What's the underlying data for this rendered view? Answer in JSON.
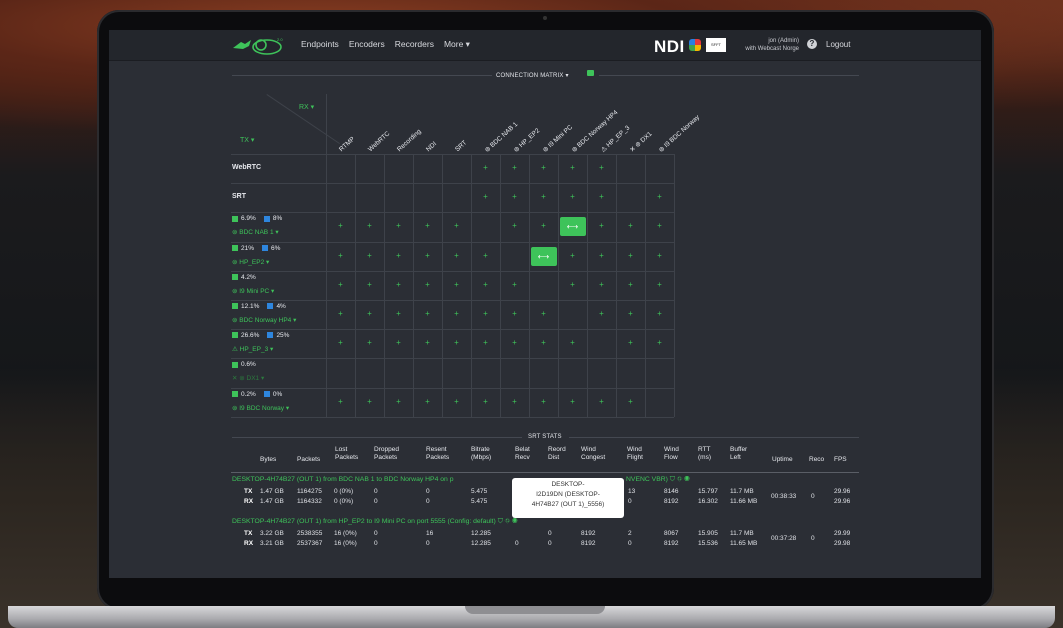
{
  "nav": {
    "items": [
      "Endpoints",
      "Encoders",
      "Recorders",
      "More ▾"
    ]
  },
  "brand": {
    "ndi": "NDI",
    "box": "SFFT",
    "user_line1": "jon (Admin)",
    "user_line2": "with Webcast Norge",
    "logout": "Logout",
    "accent": "#3ec35a"
  },
  "matrix": {
    "title": "CONNECTION MATRIX ▾",
    "rx_label": "RX ▾",
    "tx_label": "TX ▾",
    "columns": [
      "RTMP",
      "WebRTC",
      "Recording",
      "NDI",
      "SRT",
      "⊚ BDC NAB 1",
      "⊚ HP_EP2",
      "⊚ I9 Mini PC",
      "⊚ BDC Norway HP4",
      "⚠ HP_EP_3",
      "✕ ⊚ DX1",
      "⊚ I9 BDC Norway"
    ],
    "rows": [
      {
        "label": "WebRTC",
        "type": "head",
        "plus": [
          5,
          6,
          7,
          8,
          9
        ]
      },
      {
        "label": "SRT",
        "type": "head",
        "plus": [
          5,
          6,
          7,
          8,
          9,
          11
        ]
      },
      {
        "name": "⊚ BDC NAB 1 ▾",
        "g": "6.9%",
        "b": "8%",
        "plus": [
          0,
          1,
          2,
          3,
          4,
          6,
          7,
          9,
          10,
          11
        ],
        "active": 8
      },
      {
        "name": "⊚ HP_EP2 ▾",
        "g": "21%",
        "b": "6%",
        "plus": [
          0,
          1,
          2,
          3,
          4,
          5,
          8,
          9,
          10,
          11
        ],
        "active": 7
      },
      {
        "name": "⊚ I9 Mini PC ▾",
        "g": "4.2%",
        "b": "",
        "plus": [
          0,
          1,
          2,
          3,
          4,
          5,
          6,
          8,
          9,
          10,
          11
        ]
      },
      {
        "name": "⊚ BDC Norway HP4 ▾",
        "g": "12.1%",
        "b": "4%",
        "plus": [
          0,
          1,
          2,
          3,
          4,
          5,
          6,
          7,
          9,
          10,
          11
        ]
      },
      {
        "name": "⚠ HP_EP_3 ▾",
        "g": "26.6%",
        "b": "25%",
        "plus": [
          0,
          1,
          2,
          3,
          4,
          5,
          6,
          7,
          8,
          10,
          11
        ]
      },
      {
        "name": "✕ ⊚ DX1 ▾",
        "g": "0.6%",
        "b": "",
        "plus": [],
        "dim": true
      },
      {
        "name": "⊚ I9 BDC Norway ▾",
        "g": "0.2%",
        "b": "0%",
        "plus": [
          0,
          1,
          2,
          3,
          4,
          5,
          6,
          7,
          8,
          9,
          10
        ]
      }
    ]
  },
  "stats": {
    "title": "SRT STATS",
    "headers": [
      "Bytes",
      "Packets",
      "Lost\nPackets",
      "Dropped\nPackets",
      "Resent\nPackets",
      "Bitrate\n(Mbps)",
      "Belat\nRecv",
      "Reord\nDist",
      "Wind\nCongest",
      "Wind\nFlight",
      "Wind\nFlow",
      "RTT\n(ms)",
      "Buffer\nLeft",
      "Uptime",
      "Reco",
      "FPS"
    ],
    "connections": [
      {
        "label": "DESKTOP-4H74B27 (OUT 1) from BDC NAB 1 to BDC Norway HP4 on p",
        "label_tail": "NVENC VBR) ⛉ ⛗ ◉",
        "uptime": "00:38:33",
        "reco": "0",
        "rows": [
          {
            "dir": "TX",
            "bytes": "1.47 GB",
            "packets": "1164275",
            "lost": "0 (0%)",
            "dropped": "0",
            "resent": "0",
            "bitrate": "5.475",
            "belat": "",
            "reord": "",
            "congest": "",
            "flight": "13",
            "flow": "8146",
            "rtt": "15.797",
            "buffer": "11.7 MB",
            "fps": "29.96"
          },
          {
            "dir": "RX",
            "bytes": "1.47 GB",
            "packets": "1164332",
            "lost": "0 (0%)",
            "dropped": "0",
            "resent": "0",
            "bitrate": "5.475",
            "belat": "",
            "reord": "",
            "congest": "",
            "flight": "0",
            "flow": "8192",
            "rtt": "16.302",
            "buffer": "11.66 MB",
            "fps": "29.96"
          }
        ]
      },
      {
        "label": "DESKTOP-4H74B27 (OUT 1) from HP_EP2 to I9 Mini PC on port 5555 (Config: default) ⛉ ⛗ ◉",
        "label_tail": "",
        "uptime": "00:37:28",
        "reco": "0",
        "rows": [
          {
            "dir": "TX",
            "bytes": "3.22 GB",
            "packets": "2538355",
            "lost": "16 (0%)",
            "dropped": "0",
            "resent": "16",
            "bitrate": "12.285",
            "belat": "",
            "reord": "0",
            "congest": "8192",
            "flight": "2",
            "flow": "8067",
            "rtt": "15.905",
            "buffer": "11.7 MB",
            "fps": "29.99"
          },
          {
            "dir": "RX",
            "bytes": "3.21 GB",
            "packets": "2537367",
            "lost": "16 (0%)",
            "dropped": "0",
            "resent": "0",
            "bitrate": "12.285",
            "belat": "0",
            "reord": "0",
            "congest": "8192",
            "flight": "0",
            "flow": "8192",
            "rtt": "15.536",
            "buffer": "11.65 MB",
            "fps": "29.98"
          }
        ]
      }
    ],
    "tooltip": [
      "DESKTOP-",
      "I2D19DN (DESKTOP-",
      "4H74B27 (OUT 1)_5556)"
    ]
  }
}
